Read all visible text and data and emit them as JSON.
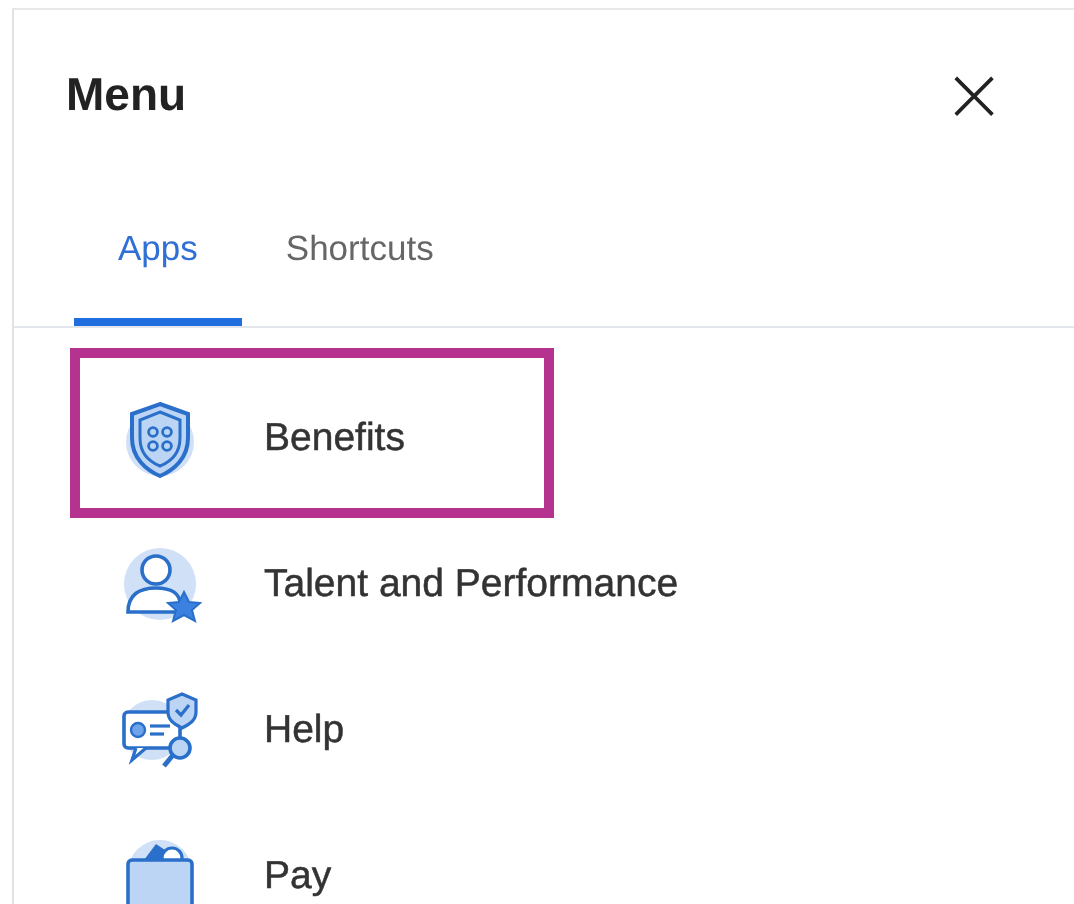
{
  "menu": {
    "title": "Menu",
    "close": "×"
  },
  "tabs": [
    {
      "label": "Apps",
      "selected": true
    },
    {
      "label": "Shortcuts",
      "selected": false
    }
  ],
  "apps": [
    {
      "label": "Benefits",
      "kind": "shield",
      "highlighted": true
    },
    {
      "label": "Talent and Performance",
      "kind": "person-star",
      "highlighted": false
    },
    {
      "label": "Help",
      "kind": "id-card",
      "highlighted": false
    },
    {
      "label": "Pay",
      "kind": "wallet",
      "highlighted": false
    }
  ]
}
